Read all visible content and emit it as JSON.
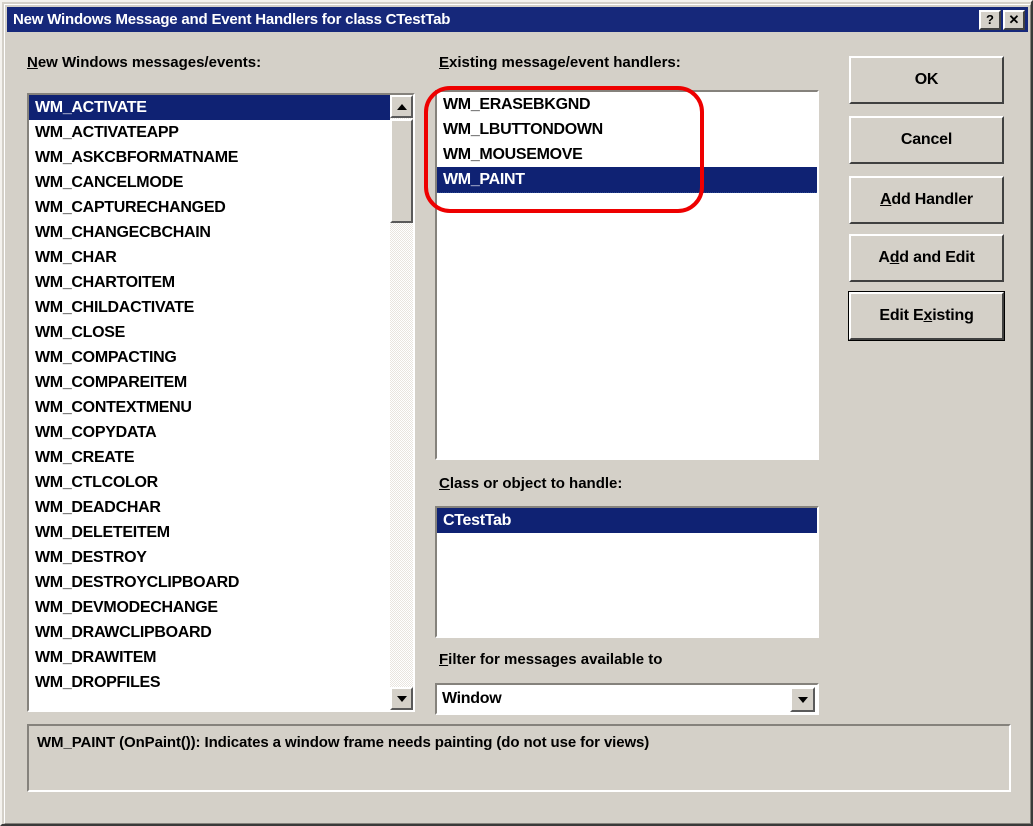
{
  "window": {
    "title": "New Windows Message and Event Handlers for class CTestTab",
    "help_button": "?",
    "close_button": "✕"
  },
  "new_messages": {
    "label_prefix": "N",
    "label_rest": "ew Windows messages/events:",
    "items": [
      "WM_ACTIVATE",
      "WM_ACTIVATEAPP",
      "WM_ASKCBFORMATNAME",
      "WM_CANCELMODE",
      "WM_CAPTURECHANGED",
      "WM_CHANGECBCHAIN",
      "WM_CHAR",
      "WM_CHARTOITEM",
      "WM_CHILDACTIVATE",
      "WM_CLOSE",
      "WM_COMPACTING",
      "WM_COMPAREITEM",
      "WM_CONTEXTMENU",
      "WM_COPYDATA",
      "WM_CREATE",
      "WM_CTLCOLOR",
      "WM_DEADCHAR",
      "WM_DELETEITEM",
      "WM_DESTROY",
      "WM_DESTROYCLIPBOARD",
      "WM_DEVMODECHANGE",
      "WM_DRAWCLIPBOARD",
      "WM_DRAWITEM",
      "WM_DROPFILES"
    ],
    "selected_index": 0,
    "scroll_up_arrow": "▲",
    "scroll_down_arrow": "▼"
  },
  "existing_handlers": {
    "label_prefix": "E",
    "label_rest": "xisting message/event handlers:",
    "items": [
      "WM_ERASEBKGND",
      "WM_LBUTTONDOWN",
      "WM_MOUSEMOVE",
      "WM_PAINT"
    ],
    "selected_index": 3
  },
  "class_object": {
    "label_prefix": "C",
    "label_rest": "lass or object to handle:",
    "items": [
      "CTestTab"
    ],
    "selected_index": 0
  },
  "filter": {
    "label_prefix": "F",
    "label_rest": "ilter for messages available to",
    "value": "Window",
    "dropdown_arrow": "▼"
  },
  "buttons": [
    {
      "name": "ok-button",
      "pre": "",
      "accel": "",
      "post": "OK",
      "default": false
    },
    {
      "name": "cancel-button",
      "pre": "",
      "accel": "",
      "post": "Cancel",
      "default": false
    },
    {
      "name": "add-handler-button",
      "pre": "",
      "accel": "A",
      "post": "dd Handler",
      "default": false
    },
    {
      "name": "add-and-edit-button",
      "pre": "A",
      "accel": "d",
      "post": "d and Edit",
      "default": false
    },
    {
      "name": "edit-existing-button",
      "pre": "Edit E",
      "accel": "x",
      "post": "isting",
      "default": true
    }
  ],
  "status": {
    "text": "WM_PAINT (OnPaint()):  Indicates a window frame needs painting (do not use for views)"
  },
  "colors": {
    "titlebar": "#16287a",
    "selection": "#0f2273",
    "dialog_face": "#d4d0c8",
    "annotation": "#ee0000"
  }
}
